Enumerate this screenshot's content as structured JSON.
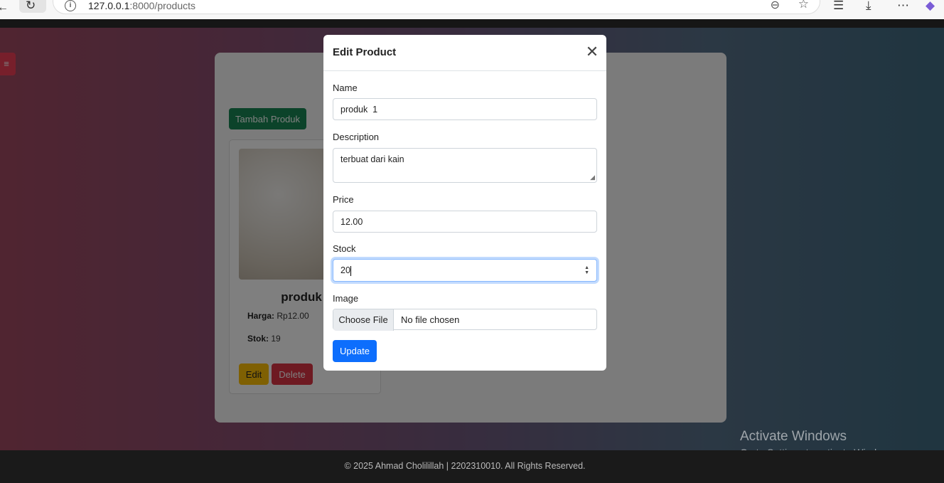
{
  "browser": {
    "url_host": "127.0.0.1",
    "url_path": ":8000/products"
  },
  "page": {
    "menu_icon": "≡",
    "add_button": "Tambah Produk",
    "card": {
      "title": "produk",
      "price_label": "Harga:",
      "price_value": "Rp12.00",
      "stock_label": "Stok:",
      "stock_value": "19",
      "edit_button": "Edit",
      "delete_button": "Delete"
    }
  },
  "modal": {
    "title": "Edit Product",
    "name_label": "Name",
    "name_value": "produk  1",
    "description_label": "Description",
    "description_value": "terbuat dari kain",
    "price_label": "Price",
    "price_value": "12.00",
    "stock_label": "Stock",
    "stock_value": "20",
    "image_label": "Image",
    "file_button": "Choose File",
    "file_status": "No file chosen",
    "update_button": "Update"
  },
  "watermark": {
    "line1": "Activate Windows",
    "line2": "Go to Settings to activate Windows."
  },
  "footer": {
    "text": "© 2025 Ahmad Cholilillah | 2202310010. All Rights Reserved."
  }
}
